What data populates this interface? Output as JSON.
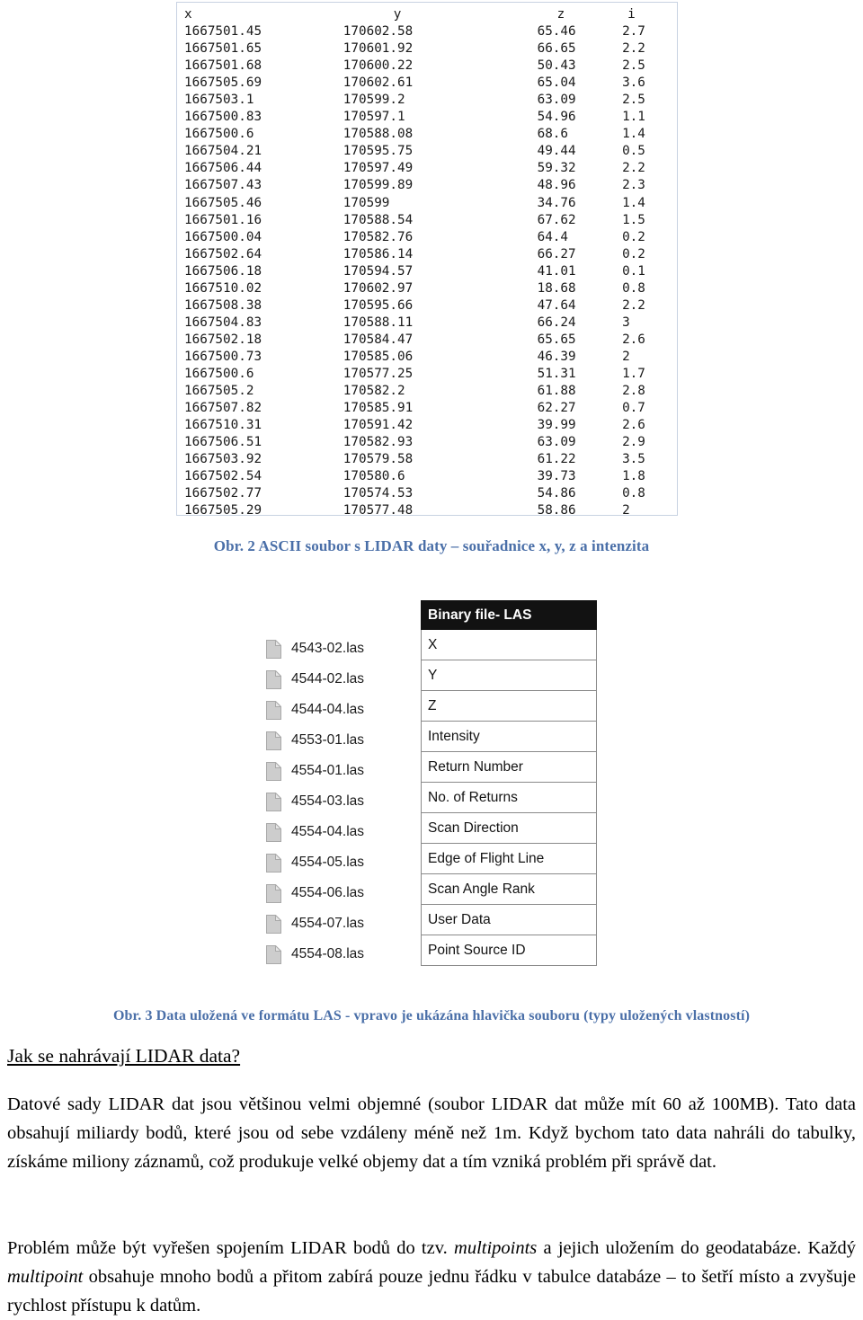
{
  "figure_ascii": {
    "columns": [
      "x",
      "y",
      "z",
      "i"
    ],
    "rows": [
      [
        "1667501.45",
        "170602.58",
        "65.46",
        "2.7"
      ],
      [
        "1667501.65",
        "170601.92",
        "66.65",
        "2.2"
      ],
      [
        "1667501.68",
        "170600.22",
        "50.43",
        "2.5"
      ],
      [
        "1667505.69",
        "170602.61",
        "65.04",
        "3.6"
      ],
      [
        "1667503.1",
        "170599.2",
        "63.09",
        "2.5"
      ],
      [
        "1667500.83",
        "170597.1",
        "54.96",
        "1.1"
      ],
      [
        "1667500.6",
        "170588.08",
        "68.6",
        "1.4"
      ],
      [
        "1667504.21",
        "170595.75",
        "49.44",
        "0.5"
      ],
      [
        "1667506.44",
        "170597.49",
        "59.32",
        "2.2"
      ],
      [
        "1667507.43",
        "170599.89",
        "48.96",
        "2.3"
      ],
      [
        "1667505.46",
        "170599",
        "34.76",
        "1.4"
      ],
      [
        "1667501.16",
        "170588.54",
        "67.62",
        "1.5"
      ],
      [
        "1667500.04",
        "170582.76",
        "64.4",
        "0.2"
      ],
      [
        "1667502.64",
        "170586.14",
        "66.27",
        "0.2"
      ],
      [
        "1667506.18",
        "170594.57",
        "41.01",
        "0.1"
      ],
      [
        "1667510.02",
        "170602.97",
        "18.68",
        "0.8"
      ],
      [
        "1667508.38",
        "170595.66",
        "47.64",
        "2.2"
      ],
      [
        "1667504.83",
        "170588.11",
        "66.24",
        "3"
      ],
      [
        "1667502.18",
        "170584.47",
        "65.65",
        "2.6"
      ],
      [
        "1667500.73",
        "170585.06",
        "46.39",
        "2"
      ],
      [
        "1667500.6",
        "170577.25",
        "51.31",
        "1.7"
      ],
      [
        "1667505.2",
        "170582.2",
        "61.88",
        "2.8"
      ],
      [
        "1667507.82",
        "170585.91",
        "62.27",
        "0.7"
      ],
      [
        "1667510.31",
        "170591.42",
        "39.99",
        "2.6"
      ],
      [
        "1667506.51",
        "170582.93",
        "63.09",
        "2.9"
      ],
      [
        "1667503.92",
        "170579.58",
        "61.22",
        "3.5"
      ],
      [
        "1667502.54",
        "170580.6",
        "39.73",
        "1.8"
      ],
      [
        "1667502.77",
        "170574.53",
        "54.86",
        "0.8"
      ],
      [
        "1667505.29",
        "170577.48",
        "58.86",
        "2"
      ]
    ]
  },
  "caption_fig2": "Obr. 2 ASCII soubor s LIDAR daty – souřadnice x, y, z a intenzita",
  "figure_las": {
    "files": [
      "4543-02.las",
      "4544-02.las",
      "4544-04.las",
      "4553-01.las",
      "4554-01.las",
      "4554-03.las",
      "4554-04.las",
      "4554-05.las",
      "4554-06.las",
      "4554-07.las",
      "4554-08.las"
    ],
    "header_label": "Binary file- LAS",
    "fields": [
      "X",
      "Y",
      "Z",
      "Intensity",
      "Return Number",
      "No. of Returns",
      "Scan Direction",
      "Edge of Flight Line",
      "Scan Angle Rank",
      "User Data",
      "Point Source ID"
    ]
  },
  "caption_fig3": "Obr. 3 Data uložená ve formátu LAS - vpravo je ukázána hlavička souboru (typy uložených vlastností)",
  "heading": "Jak se nahrávají LIDAR data?",
  "paragraph_1": {
    "text": "Datové sady LIDAR dat jsou většinou velmi objemné (soubor LIDAR dat může mít 60 až 100MB). Tato data obsahují miliardy bodů, které jsou od sebe vzdáleny méně než 1m. Když bychom tato data nahráli do tabulky, získáme miliony záznamů, což produkuje velké objemy dat a tím vzniká problém při správě dat."
  },
  "paragraph_2": {
    "part_1": "Problém může být vyřešen spojením LIDAR bodů do tzv. ",
    "italic_1": "multipoints",
    "part_2": " a jejich uložením do geodatabáze. Každý ",
    "italic_2": "multipoint",
    "part_3": " obsahuje mnoho bodů a přitom zabírá pouze jednu řádku v tabulce databáze – to šetří místo a zvyšuje rychlost přístupu k datům."
  },
  "colors": {
    "caption": "#4a6fa8",
    "box_border": "#c8d2e2",
    "las_header_bg": "#121212",
    "file_icon": "#c9c9c9"
  }
}
